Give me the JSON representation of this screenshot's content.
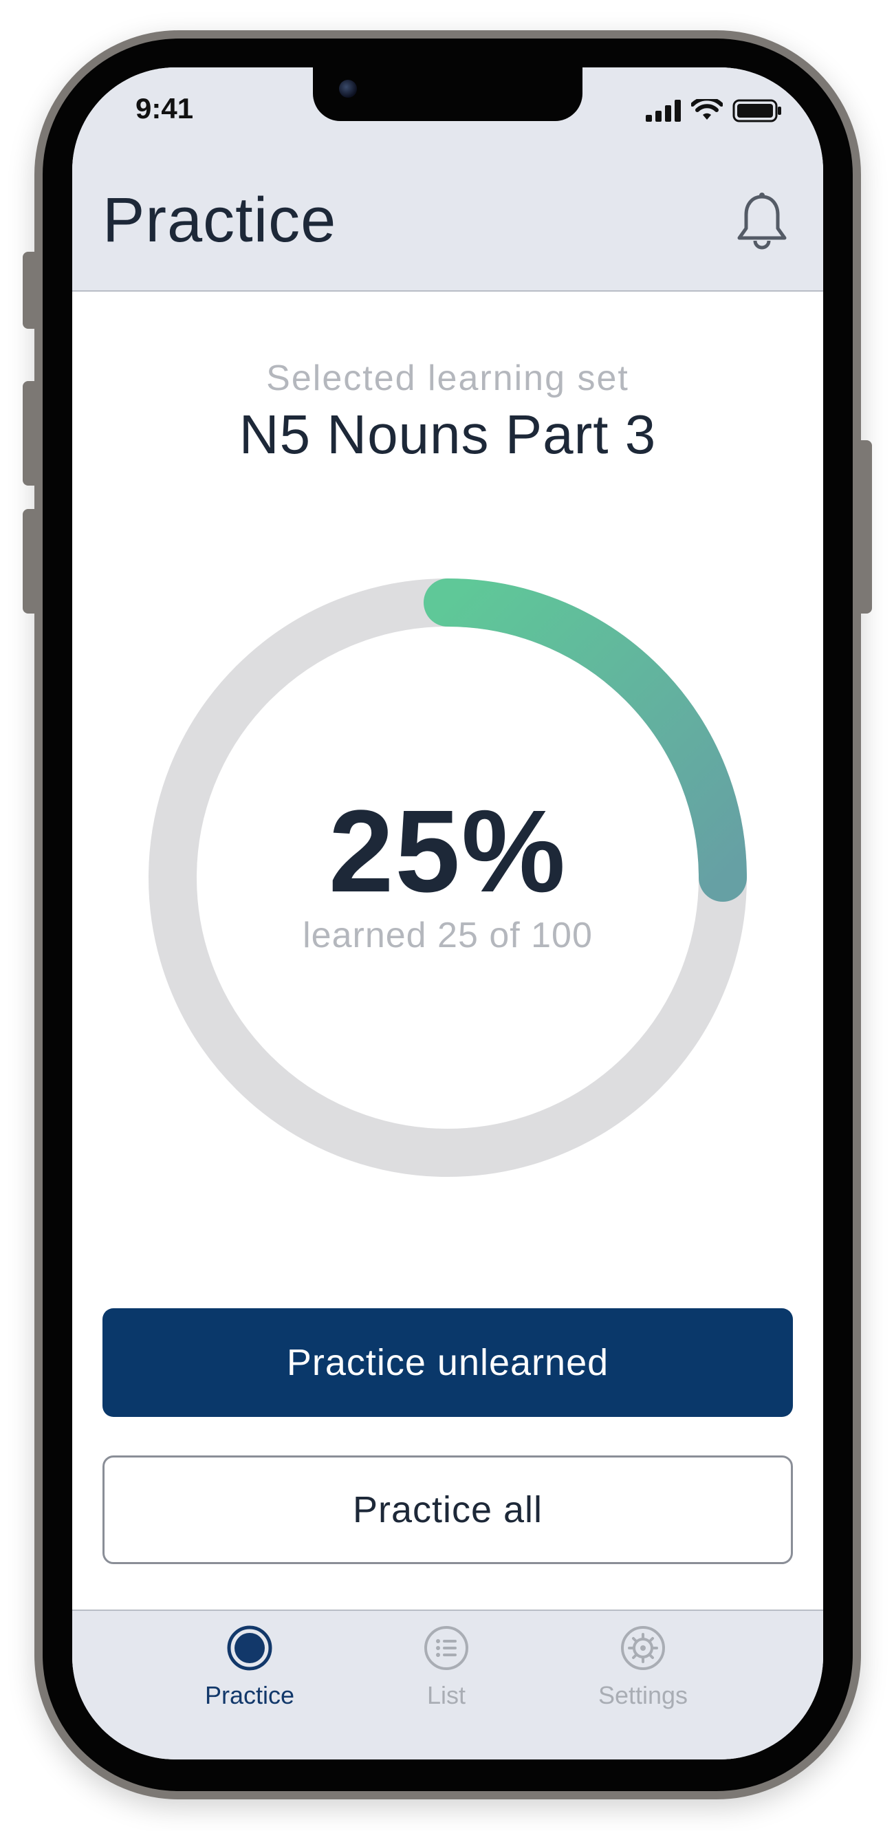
{
  "status_bar": {
    "time": "9:41"
  },
  "header": {
    "title": "Practice"
  },
  "learning_set": {
    "caption": "Selected learning set",
    "name": "N5 Nouns Part 3"
  },
  "progress": {
    "percent_label": "25%",
    "learned_label": "learned 25 of 100",
    "fraction": 0.25
  },
  "actions": {
    "practice_unlearned": "Practice unlearned",
    "practice_all": "Practice all"
  },
  "tab_bar": {
    "tabs": [
      {
        "label": "Practice",
        "icon": "practice-circle-icon",
        "active": true
      },
      {
        "label": "List",
        "icon": "list-icon",
        "active": false
      },
      {
        "label": "Settings",
        "icon": "settings-gear-icon",
        "active": false
      }
    ]
  },
  "colors": {
    "primary": "#0a386a",
    "ring_track": "#dddddf",
    "ring_start": "#5fc898",
    "ring_end": "#66a0a4",
    "header_bg": "#e4e7ee",
    "text_dark": "#1d2838",
    "text_muted": "#b4b7bd"
  }
}
